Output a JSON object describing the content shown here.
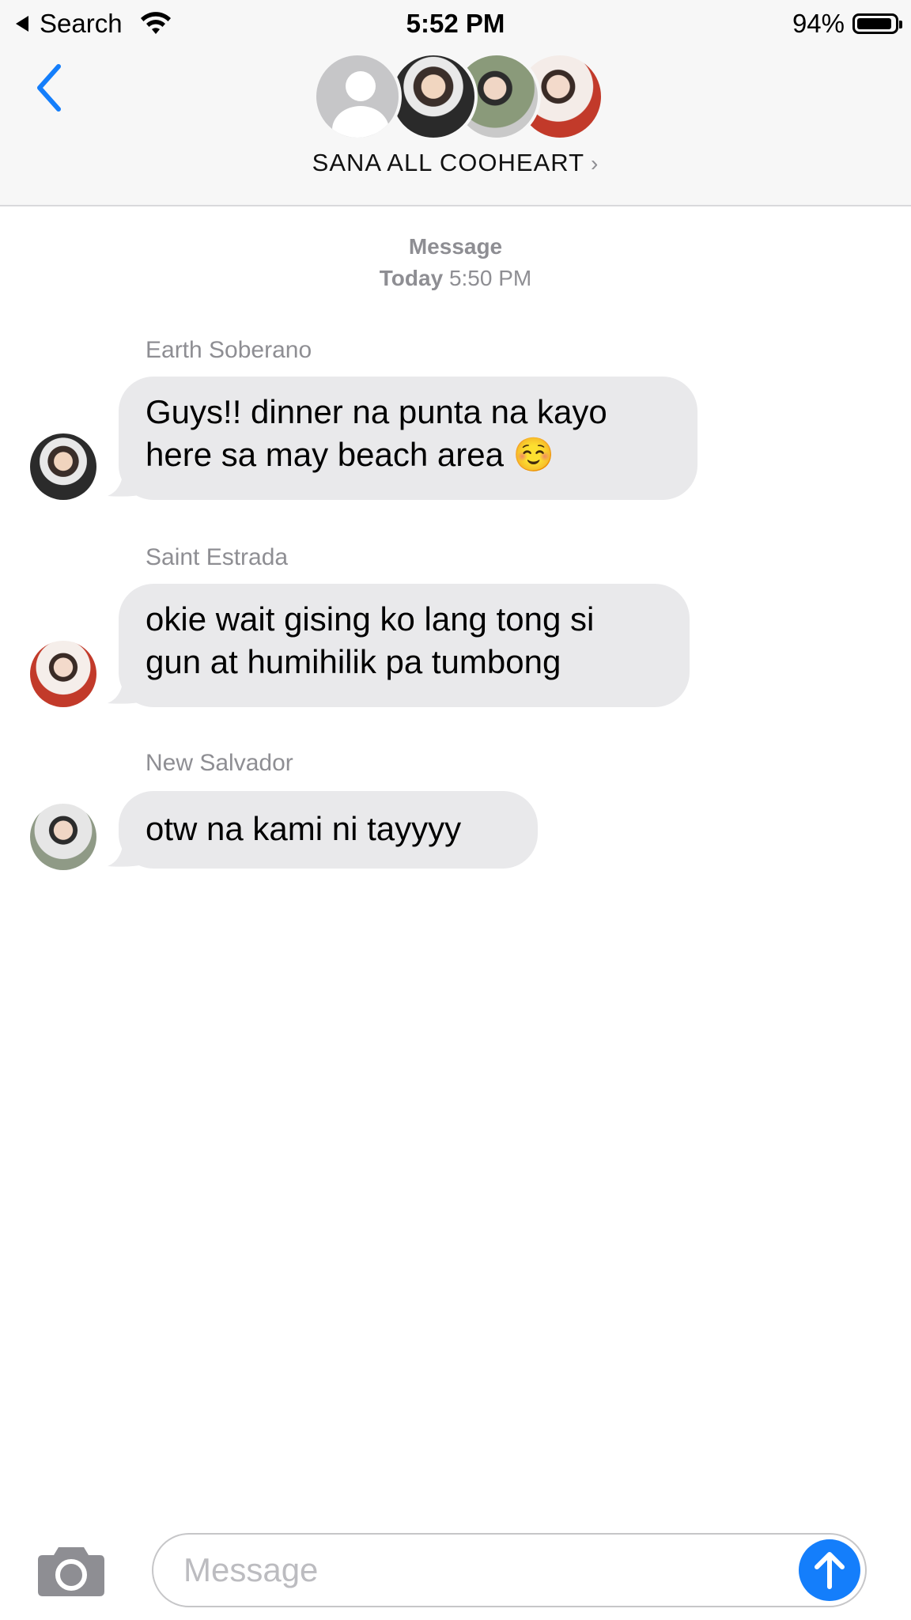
{
  "status_bar": {
    "back_app": "Search",
    "time": "5:52 PM",
    "battery": "94%",
    "battery_level": 0.94
  },
  "header": {
    "title": "SANA ALL COOHEART",
    "title_chevron": "›",
    "icons": {
      "back": "chevron-left-icon",
      "placeholder_avatar": "person-icon"
    }
  },
  "conversation": {
    "service": "Message",
    "day": "Today",
    "time": "5:50 PM",
    "messages": [
      {
        "sender": "Earth Soberano",
        "lines": [
          "Guys!! dinner na punta na kayo",
          "here sa may beach area ☺️"
        ]
      },
      {
        "sender": "Saint Estrada",
        "lines": [
          "okie wait gising ko lang tong si",
          "gun at humihilik pa tumbong"
        ]
      },
      {
        "sender": "New Salvador",
        "lines": [
          "otw na kami ni tayyyy"
        ]
      }
    ]
  },
  "input_bar": {
    "placeholder": "Message",
    "icons": {
      "camera": "camera-icon",
      "send": "arrow-up-icon"
    }
  },
  "colors": {
    "accent": "#147efb",
    "bubble": "#e9e9eb",
    "secondary_text": "#8e8e93",
    "header_bg": "#f7f7f7"
  }
}
